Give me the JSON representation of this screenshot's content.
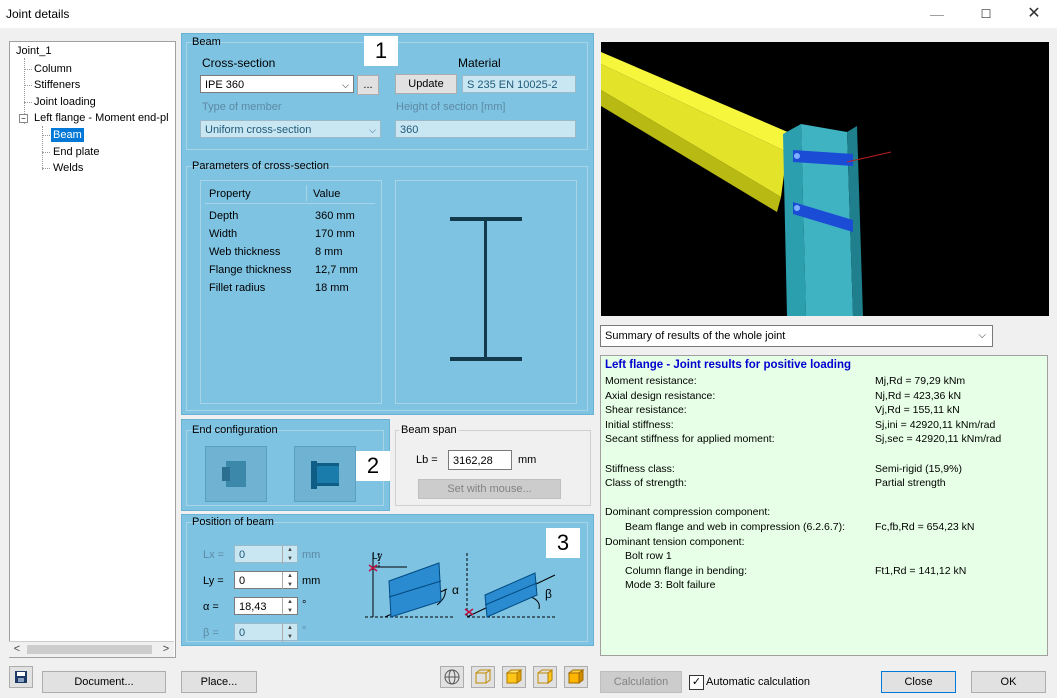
{
  "window": {
    "title": "Joint details"
  },
  "tree": {
    "root": "Joint_1",
    "items": [
      "Column",
      "Stiffeners",
      "Joint loading",
      "Left flange - Moment end-pl"
    ],
    "sub_items": [
      "Beam",
      "End plate",
      "Welds"
    ]
  },
  "beam": {
    "group_label": "Beam",
    "cross_section_label": "Cross-section",
    "cross_section_value": "IPE 360",
    "ellipsis_label": "...",
    "material_label": "Material",
    "update_label": "Update",
    "material_value": "S 235 EN 10025-2",
    "type_label": "Type of member",
    "type_value": "Uniform cross-section",
    "height_label": "Height of section [mm]",
    "height_value": "360",
    "badge": "1"
  },
  "params": {
    "group_label": "Parameters of cross-section",
    "col_property": "Property",
    "col_value": "Value",
    "rows": [
      {
        "property": "Depth",
        "value": "360 mm"
      },
      {
        "property": "Width",
        "value": "170 mm"
      },
      {
        "property": "Web thickness",
        "value": "8 mm"
      },
      {
        "property": "Flange thickness",
        "value": "12,7 mm"
      },
      {
        "property": "Fillet radius",
        "value": "18 mm"
      }
    ]
  },
  "end_config": {
    "group_label": "End configuration",
    "badge": "2"
  },
  "beam_span": {
    "group_label": "Beam span",
    "lb_label": "Lb =",
    "lb_value": "3162,28",
    "lb_unit": "mm",
    "set_mouse_label": "Set with mouse..."
  },
  "position": {
    "group_label": "Position of beam",
    "badge": "3",
    "lx_label": "Lx =",
    "lx_value": "0",
    "lx_unit": "mm",
    "ly_label": "Ly =",
    "ly_value": "0",
    "ly_unit": "mm",
    "alpha_label": "α =",
    "alpha_value": "18,43",
    "alpha_unit": "°",
    "beta_label": "β =",
    "beta_value": "0",
    "beta_unit": "°",
    "diagram_ly": "Ly",
    "diagram_alpha": "α",
    "diagram_beta": "β"
  },
  "results": {
    "dropdown_value": "Summary of results of the whole joint",
    "heading": "Left flange - Joint results for positive loading",
    "lines": [
      {
        "label": "Moment resistance:",
        "value": "Mj,Rd = 79,29 kNm",
        "indent": 0
      },
      {
        "label": "Axial design resistance:",
        "value": "Nj,Rd = 423,36 kN",
        "indent": 0
      },
      {
        "label": "Shear resistance:",
        "value": "Vj,Rd = 155,11 kN",
        "indent": 0
      },
      {
        "label": "Initial stiffness:",
        "value": "Sj,ini = 42920,11 kNm/rad",
        "indent": 0
      },
      {
        "label": "Secant stiffness for applied moment:",
        "value": "Sj,sec = 42920,11 kNm/rad",
        "indent": 0
      },
      {
        "label": "",
        "value": "",
        "indent": 0
      },
      {
        "label": "Stiffness class:",
        "value": "Semi-rigid (15,9%)",
        "indent": 0
      },
      {
        "label": "Class of strength:",
        "value": "Partial strength",
        "indent": 0
      },
      {
        "label": "",
        "value": "",
        "indent": 0
      },
      {
        "label": "Dominant compression component:",
        "value": "",
        "indent": 0
      },
      {
        "label": "Beam flange and web in compression (6.2.6.7):",
        "value": "Fc,fb,Rd = 654,23 kN",
        "indent": 1
      },
      {
        "label": "Dominant tension component:",
        "value": "",
        "indent": 0
      },
      {
        "label": "Bolt row 1",
        "value": "",
        "indent": 1
      },
      {
        "label": "Column flange in bending:",
        "value": "Ft1,Rd = 141,12 kN",
        "indent": 1
      },
      {
        "label": "Mode 3: Bolt failure",
        "value": "",
        "indent": 1
      }
    ]
  },
  "bottom": {
    "document_label": "Document...",
    "place_label": "Place...",
    "calculation_label": "Calculation",
    "auto_calc_label": "Automatic calculation",
    "close_label": "Close",
    "ok_label": "OK"
  }
}
